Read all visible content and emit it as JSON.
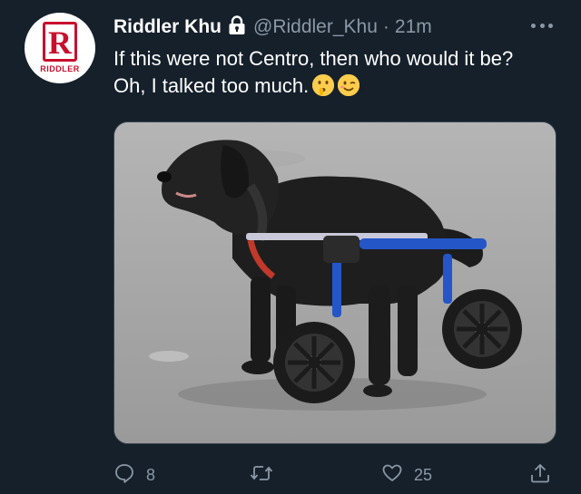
{
  "tweet": {
    "display_name": "Riddler Khu",
    "handle": "@Riddler_Khu",
    "separator": "·",
    "time": "21m",
    "line1": "If this were not Centro, then who would it be?",
    "line2": "Oh, I talked too much.",
    "emojis": [
      "shushing-face",
      "winking-face"
    ]
  },
  "avatar": {
    "letter": "R",
    "brand_text": "RIDDLER",
    "brand_color": "#c8102e"
  },
  "media": {
    "subject": "black-dog-in-blue-wheelchair-photo"
  },
  "actions": {
    "reply_count": "8",
    "retweet_count": "",
    "like_count": "25"
  },
  "colors": {
    "background": "#15202b",
    "muted": "#8b98a5",
    "text": "#ffffff"
  }
}
